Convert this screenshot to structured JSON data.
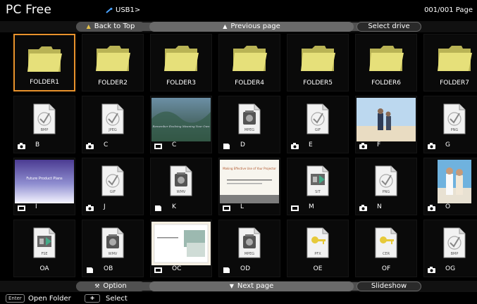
{
  "header": {
    "app_title": "PC Free",
    "breadcrumb": "USB1>",
    "page_indicator": "001/001 Page"
  },
  "top_buttons": {
    "back_to_top": "Back to Top",
    "previous_page": "Previous page",
    "select_drive": "Select drive"
  },
  "bottom_buttons": {
    "option": "Option",
    "next_page": "Next page",
    "slideshow": "Slideshow"
  },
  "status": {
    "enter_key": "Enter",
    "enter_hint": "Open Folder",
    "arrows_hint": "Select"
  },
  "rows": [
    [
      {
        "label": "FOLDER1",
        "kind": "folder",
        "selected": true
      },
      {
        "label": "FOLDER2",
        "kind": "folder"
      },
      {
        "label": "FOLDER3",
        "kind": "folder"
      },
      {
        "label": "FOLDER4",
        "kind": "folder"
      },
      {
        "label": "FOLDER5",
        "kind": "folder"
      },
      {
        "label": "FOLDER6",
        "kind": "folder"
      },
      {
        "label": "FOLDER7",
        "kind": "folder"
      }
    ],
    [
      {
        "label": "B",
        "kind": "file",
        "ext": "BMP",
        "badge": "camera"
      },
      {
        "label": "C",
        "kind": "file",
        "ext": "JPEG",
        "badge": "camera"
      },
      {
        "label": "C",
        "kind": "photo",
        "badge": "slide"
      },
      {
        "label": "D",
        "kind": "media",
        "ext": "MPEG",
        "badge": "movie"
      },
      {
        "label": "E",
        "kind": "file",
        "ext": "GIF",
        "badge": "camera"
      },
      {
        "label": "F",
        "kind": "photo2",
        "badge": "camera"
      },
      {
        "label": "G",
        "kind": "file",
        "ext": "PNG",
        "badge": "camera"
      }
    ],
    [
      {
        "label": "I",
        "kind": "slide1",
        "badge": "slide"
      },
      {
        "label": "J",
        "kind": "file",
        "ext": "GIF",
        "badge": "camera"
      },
      {
        "label": "K",
        "kind": "media",
        "ext": "WMV",
        "badge": "movie"
      },
      {
        "label": "L",
        "kind": "slide2",
        "badge": "slide"
      },
      {
        "label": "M",
        "kind": "sit",
        "ext": "SIT",
        "badge": "slide"
      },
      {
        "label": "N",
        "kind": "file",
        "ext": "PNG",
        "badge": "camera"
      },
      {
        "label": "O",
        "kind": "photo3",
        "badge": "camera"
      }
    ],
    [
      {
        "label": "OA",
        "kind": "sit",
        "ext": "FSE"
      },
      {
        "label": "OB",
        "kind": "media",
        "ext": "WMV",
        "badge": "movie"
      },
      {
        "label": "OC",
        "kind": "slide3",
        "badge": "slide"
      },
      {
        "label": "OD",
        "kind": "media",
        "ext": "MPEG",
        "badge": "movie"
      },
      {
        "label": "OE",
        "kind": "key",
        "ext": "PFX"
      },
      {
        "label": "OF",
        "kind": "key",
        "ext": "CER"
      },
      {
        "label": "OG",
        "kind": "file",
        "ext": "BMP",
        "badge": "camera"
      }
    ]
  ],
  "slide_texts": {
    "slide1": "Future Product Plans",
    "slide2_title": "Making Effective Use of Your Projector",
    "photo_caption": "Remember Evolving Meaning Your Own"
  },
  "colors": {
    "selection": "#e8922c",
    "button_gray": "#505050",
    "folder_yellow": "#e6e07a"
  }
}
